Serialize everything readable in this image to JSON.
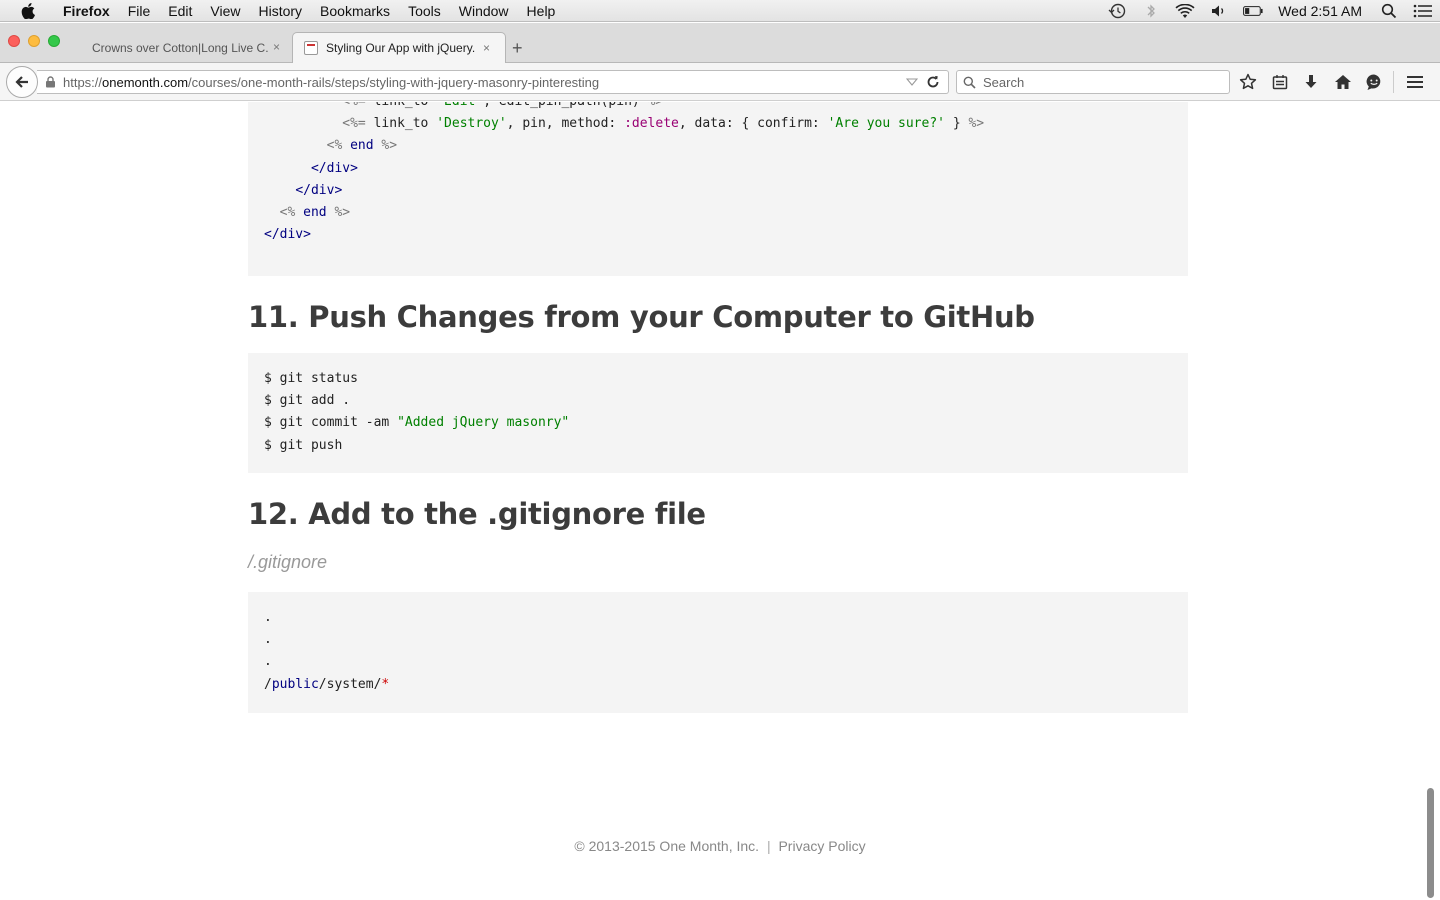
{
  "menubar": {
    "app": "Firefox",
    "items": [
      "File",
      "Edit",
      "View",
      "History",
      "Bookmarks",
      "Tools",
      "Window",
      "Help"
    ],
    "clock": "Wed 2:51 AM"
  },
  "tabs": [
    {
      "title": "Crowns over Cotton|Long Live C...",
      "close": "×"
    },
    {
      "title": "Styling Our App with jQuery...",
      "close": "×"
    }
  ],
  "newtab": "+",
  "urlbar": {
    "pre": "https://",
    "host": "onemonth.com",
    "path": "/courses/one-month-rails/steps/styling-with-jquery-masonry-pinteresting"
  },
  "searchbar": {
    "placeholder": "Search"
  },
  "content": {
    "heading_11": "11. Push Changes from your Computer to GitHub",
    "heading_12": "12. Add to the .gitignore file",
    "filepath": "/.gitignore",
    "git_commands": [
      "$ git status",
      "$ git add .",
      "$ git commit -am ",
      "$ git push"
    ],
    "commit_message": "\"Added jQuery masonry\"",
    "gitignore_lines": [
      ".",
      ".",
      "."
    ]
  },
  "footer": {
    "copyright": "© 2013-2015 One Month, Inc.",
    "separator": "|",
    "privacy": "Privacy Policy"
  }
}
